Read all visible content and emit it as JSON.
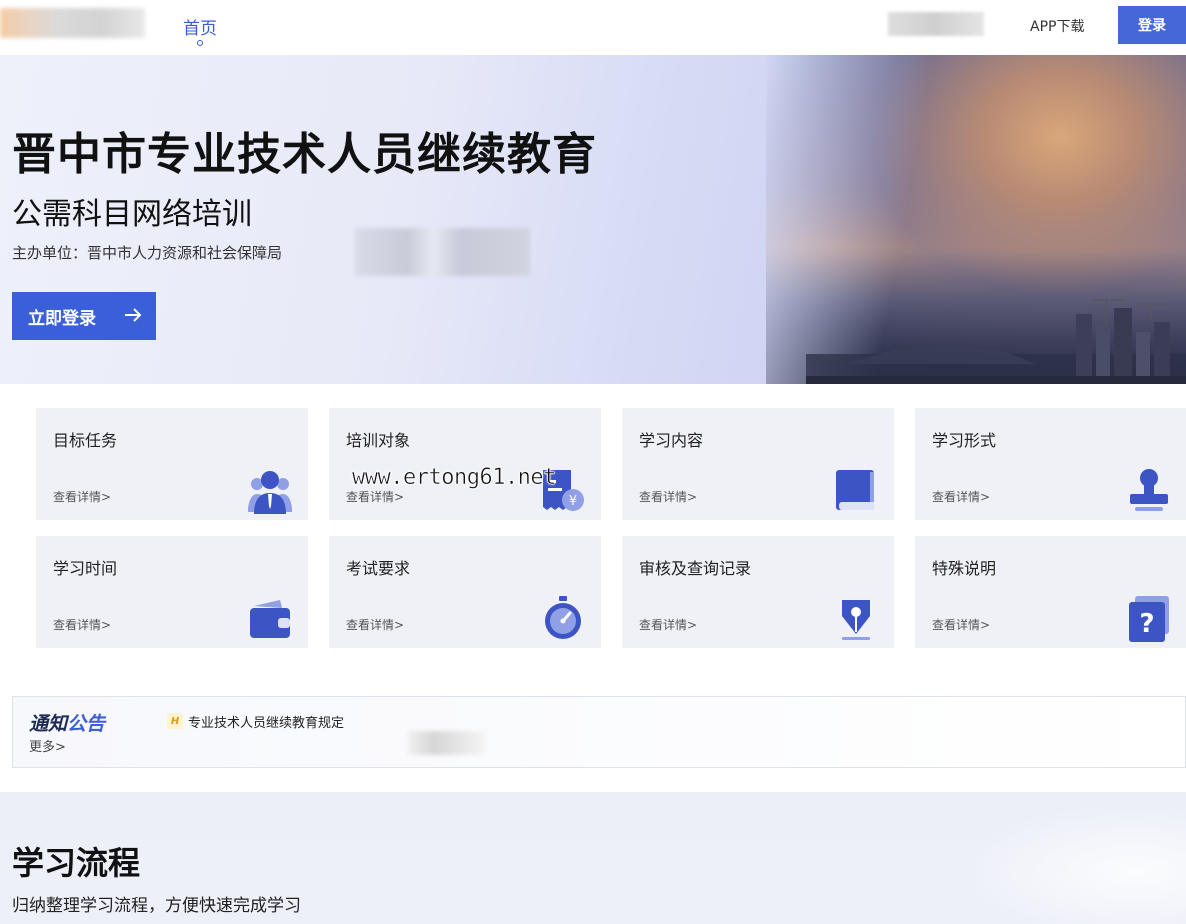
{
  "header": {
    "nav_home": "首页",
    "app_download": "APP下载",
    "login": "登录"
  },
  "hero": {
    "title": "晋中市专业技术人员继续教育",
    "subtitle": "公需科目网络培训",
    "organizer": "主办单位：晋中市人力资源和社会保障局",
    "login_now": "立即登录"
  },
  "cards": [
    {
      "title": "目标任务",
      "more": "查看详情>",
      "icon": "users-icon"
    },
    {
      "title": "培训对象",
      "more": "查看详情>",
      "icon": "receipt-yuan-icon"
    },
    {
      "title": "学习内容",
      "more": "查看详情>",
      "icon": "book-icon"
    },
    {
      "title": "学习形式",
      "more": "查看详情>",
      "icon": "stamp-icon"
    },
    {
      "title": "学习时间",
      "more": "查看详情>",
      "icon": "wallet-icon"
    },
    {
      "title": "考试要求",
      "more": "查看详情>",
      "icon": "stopwatch-icon"
    },
    {
      "title": "审核及查询记录",
      "more": "查看详情>",
      "icon": "pen-nib-icon"
    },
    {
      "title": "特殊说明",
      "more": "查看详情>",
      "icon": "question-icon"
    }
  ],
  "watermark": "www.ertong61.net",
  "notice": {
    "title_a": "通知",
    "title_b": "公告",
    "more": "更多>",
    "badge": "H",
    "item": "专业技术人员继续教育规定"
  },
  "process": {
    "title": "学习流程",
    "subtitle": "归纳整理学习流程，方便快速完成学习"
  },
  "colors": {
    "accent": "#3a5fd9",
    "icon_dark": "#3d55c4",
    "card_bg": "#f0f1f7"
  }
}
